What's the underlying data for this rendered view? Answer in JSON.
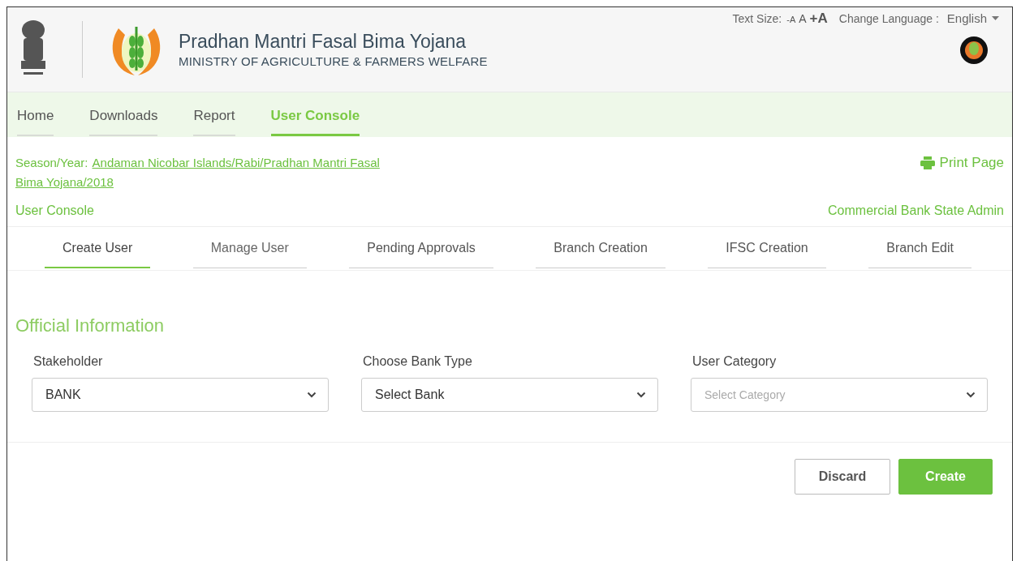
{
  "header": {
    "title": "Pradhan Mantri Fasal Bima Yojana",
    "subtitle": "MINISTRY OF AGRICULTURE & FARMERS WELFARE",
    "text_size_label": "Text Size:",
    "text_size_options": [
      "-A",
      "A",
      "+A"
    ],
    "language_label": "Change Language :",
    "language": "English"
  },
  "nav": [
    {
      "label": "Home",
      "selected": false
    },
    {
      "label": "Downloads",
      "selected": false
    },
    {
      "label": "Report",
      "selected": false
    },
    {
      "label": "User Console",
      "selected": true
    }
  ],
  "context": {
    "season_label": "Season/Year:",
    "season_value_lines": [
      "Andaman Nicobar Islands/Rabi/Pradhan Mantri Fasal",
      "Bima Yojana/2018"
    ],
    "print": "Print Page",
    "page": "User Console",
    "role": "Commercial Bank State Admin"
  },
  "tabs": [
    {
      "label": "Create User",
      "selected": true
    },
    {
      "label": "Manage User",
      "selected": false
    },
    {
      "label": "Pending Approvals",
      "selected": false
    },
    {
      "label": "Branch Creation",
      "selected": false
    },
    {
      "label": "IFSC Creation",
      "selected": false
    },
    {
      "label": "Branch Edit",
      "selected": false
    }
  ],
  "section_title": "Official Information",
  "fields": [
    {
      "label": "Stakeholder",
      "value": "BANK"
    },
    {
      "label": "Choose Bank Type",
      "value": "Select Bank"
    },
    {
      "label": "User Category",
      "placeholder": "Select Category"
    }
  ],
  "buttons": [
    {
      "label": "Discard",
      "kind": "secondary"
    },
    {
      "label": "Create",
      "kind": "primary"
    }
  ]
}
